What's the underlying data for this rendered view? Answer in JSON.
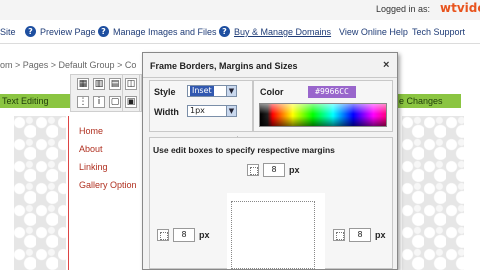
{
  "header": {
    "logged_in": "Logged in as:",
    "brand": "wtvide"
  },
  "nav": {
    "items": [
      {
        "label": "Site"
      },
      {
        "label": "Preview Page"
      },
      {
        "label": "Manage Images and Files"
      },
      {
        "label": "Buy & Manage Domains"
      },
      {
        "label": "View Online Help"
      },
      {
        "label": "Tech Support"
      }
    ]
  },
  "breadcrumb": "om > Pages > Default Group > Co",
  "editor": {
    "left_tab": "Text Editing",
    "right_tab": "e Changes",
    "menu": [
      "Home",
      "About",
      "Linking",
      "Gallery Option"
    ]
  },
  "dialog": {
    "title": "Frame Borders, Margins and Sizes",
    "close": "×",
    "style_label": "Style",
    "style_value": "Inset",
    "width_label": "Width",
    "width_value": "1px",
    "color_label": "Color",
    "color_value": "#9966CC",
    "hint": "Use edit boxes to specify respective margins",
    "margins": {
      "top": {
        "value": "8",
        "unit": "px"
      },
      "left": {
        "value": "8",
        "unit": "px"
      },
      "right": {
        "value": "8",
        "unit": "px"
      }
    }
  },
  "colors": {
    "accent_green": "#8bc542",
    "swatch": "#9966cc",
    "brand": "#e8541e"
  }
}
